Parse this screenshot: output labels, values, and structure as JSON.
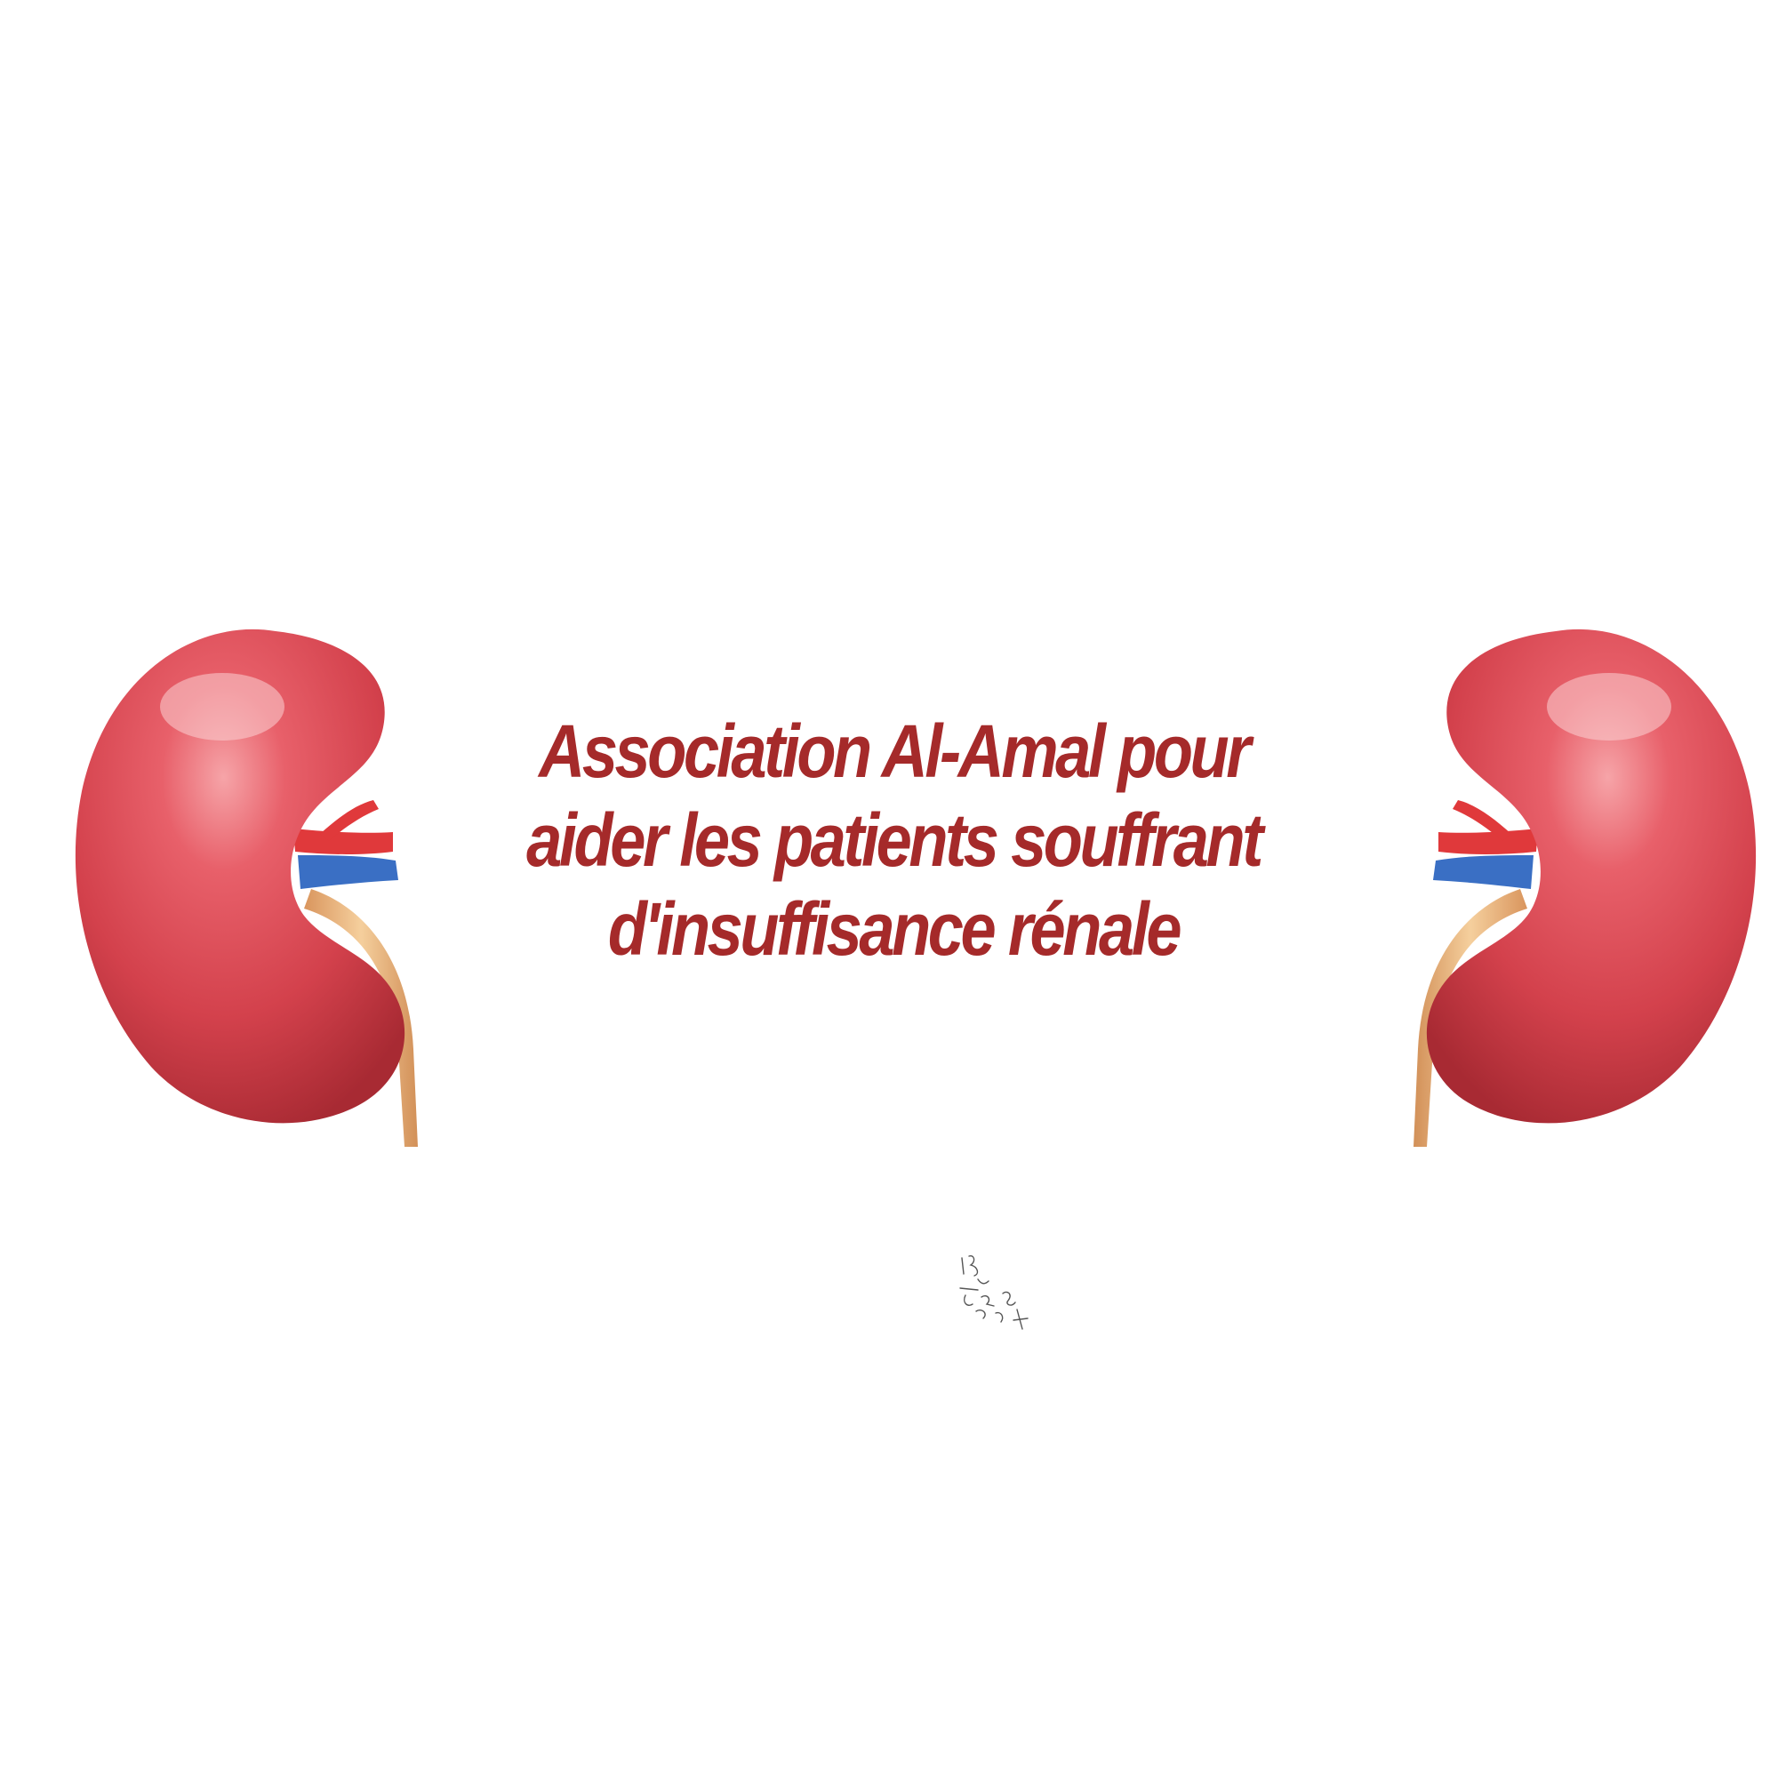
{
  "title": {
    "line1": "Association Al-Amal pour",
    "line2": "aider les patients souffrant",
    "line3": "d'insuffisance rénale"
  },
  "colors": {
    "title": "#a52a2a",
    "kidney": "#d9434f",
    "artery": "#e0393b",
    "vein": "#3a6fc4",
    "ureter": "#e8b07a",
    "background": "#ffffff"
  },
  "icons": {
    "left": "kidney-icon",
    "right": "kidney-icon",
    "mark": "scribble-signature-icon"
  }
}
